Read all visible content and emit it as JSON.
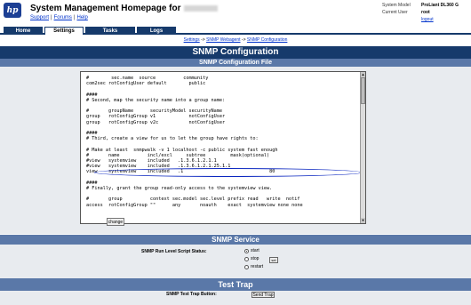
{
  "header": {
    "logo": "hp",
    "title": "System Management Homepage for",
    "links": [
      "Support",
      "Forums",
      "Help"
    ],
    "meta": {
      "system_model_label": "System Model",
      "system_model_value": "ProLiant DL360 G",
      "current_user_label": "Current User",
      "current_user_value": "root",
      "logout": "logout"
    }
  },
  "tabs": [
    "Home",
    "Settings",
    "Tasks",
    "Logs"
  ],
  "breadcrumb": [
    "Settings",
    "SNMP Webagent",
    "SNMP Configuration"
  ],
  "page_title": "SNMP Configuration",
  "config_file_title": "SNMP Configuration File",
  "config_lines": [
    "#        sec.name  source          community",
    "com2sec rotConfigUser default        public",
    "",
    "####",
    "# Second, map the security name into a group name:",
    "",
    "#       groupName      securityModel securityName",
    "group   rotConfigGroup v1            notConfigUser",
    "group   rotConfigGroup v2c           notConfigUser",
    "",
    "####",
    "# Third, create a view for us to let the group have rights to:",
    "",
    "# Make at least  snmpwalk -v 1 localhost -c public system fast enough",
    "#       name          incl/excl     subtree         mask(optional)",
    "#view   systemview    included   .1.3.6.1.2.1.1",
    "#view   systemview    included   .1.3.6.1.2.1.25.1.1",
    "view    systemview    included   .1                               80",
    "",
    "####",
    "# Finally, grant the group read-only access to the systemview view.",
    "",
    "#       group          context sec.model sec.level prefix read   write  notif",
    "access  rotConfigGroup \"\"      any       noauth    exact  systemview none none"
  ],
  "change_button": "change",
  "service": {
    "title": "SNMP Service",
    "label": "SNMP Run Level Script Status:",
    "options": [
      "start",
      "stop",
      "restart"
    ],
    "selected": "start",
    "set_button": "set"
  },
  "test_trap": {
    "title": "Test Trap",
    "label": "SNMP Test Trap Button:",
    "button": "Send Trap"
  }
}
